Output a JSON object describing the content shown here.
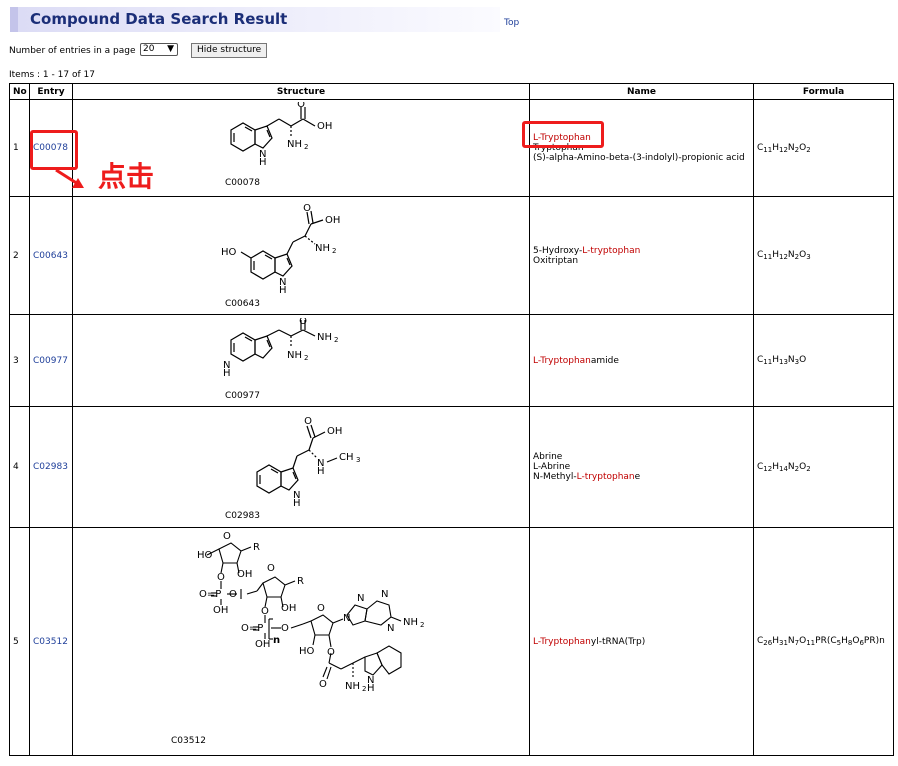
{
  "page": {
    "title": "Compound Data Search Result",
    "top_link": "Top",
    "entries_label": "Number of entries in a page",
    "entries_value": "20",
    "hide_button": "Hide structure",
    "items_text": "Items : 1 - 17 of 17",
    "annotation": "点击"
  },
  "table": {
    "headers": [
      "No",
      "Entry",
      "Structure",
      "Name",
      "Formula"
    ],
    "rows": [
      {
        "no": "1",
        "entry": "C00078",
        "struct_label": "C00078",
        "names": [
          [
            {
              "t": "L-Tryptophan",
              "hl": true
            }
          ],
          [
            {
              "t": "Tryptophan",
              "hl": false
            }
          ],
          [
            {
              "t": "(S)-alpha-Amino-beta-(3-indolyl)-propionic acid",
              "hl": false
            }
          ]
        ],
        "formula": [
          [
            "C",
            ""
          ],
          [
            "11",
            "sub"
          ],
          [
            "H",
            ""
          ],
          [
            "12",
            "sub"
          ],
          [
            "N",
            ""
          ],
          [
            "2",
            "sub"
          ],
          [
            "O",
            ""
          ],
          [
            "2",
            "sub"
          ]
        ]
      },
      {
        "no": "2",
        "entry": "C00643",
        "struct_label": "C00643",
        "names": [
          [
            {
              "t": "5-Hydroxy-",
              "hl": false
            },
            {
              "t": "L-tryptophan",
              "hl": true
            }
          ],
          [
            {
              "t": "Oxitriptan",
              "hl": false
            }
          ]
        ],
        "formula": [
          [
            "C",
            ""
          ],
          [
            "11",
            "sub"
          ],
          [
            "H",
            ""
          ],
          [
            "12",
            "sub"
          ],
          [
            "N",
            ""
          ],
          [
            "2",
            "sub"
          ],
          [
            "O",
            ""
          ],
          [
            "3",
            "sub"
          ]
        ]
      },
      {
        "no": "3",
        "entry": "C00977",
        "struct_label": "C00977",
        "names": [
          [
            {
              "t": "L-Tryptophan",
              "hl": true
            },
            {
              "t": "amide",
              "hl": false
            }
          ]
        ],
        "formula": [
          [
            "C",
            ""
          ],
          [
            "11",
            "sub"
          ],
          [
            "H",
            ""
          ],
          [
            "13",
            "sub"
          ],
          [
            "N",
            ""
          ],
          [
            "3",
            "sub"
          ],
          [
            "O",
            ""
          ]
        ]
      },
      {
        "no": "4",
        "entry": "C02983",
        "struct_label": "C02983",
        "names": [
          [
            {
              "t": "Abrine",
              "hl": false
            }
          ],
          [
            {
              "t": "L-Abrine",
              "hl": false
            }
          ],
          [
            {
              "t": "N-Methyl-",
              "hl": false
            },
            {
              "t": "L-tryptophan",
              "hl": true
            },
            {
              "t": "e",
              "hl": false
            }
          ]
        ],
        "formula": [
          [
            "C",
            ""
          ],
          [
            "12",
            "sub"
          ],
          [
            "H",
            ""
          ],
          [
            "14",
            "sub"
          ],
          [
            "N",
            ""
          ],
          [
            "2",
            "sub"
          ],
          [
            "O",
            ""
          ],
          [
            "2",
            "sub"
          ]
        ]
      },
      {
        "no": "5",
        "entry": "C03512",
        "struct_label": "C03512",
        "names": [
          [
            {
              "t": "L-Tryptophan",
              "hl": true
            },
            {
              "t": "yl-tRNA(Trp)",
              "hl": false
            }
          ]
        ],
        "formula": [
          [
            "C",
            ""
          ],
          [
            "26",
            "sub"
          ],
          [
            "H",
            ""
          ],
          [
            "31",
            "sub"
          ],
          [
            "N",
            ""
          ],
          [
            "7",
            "sub"
          ],
          [
            "O",
            ""
          ],
          [
            "11",
            "sub"
          ],
          [
            "PR(C",
            ""
          ],
          [
            "5",
            "sub"
          ],
          [
            "H",
            ""
          ],
          [
            "8",
            "sub"
          ],
          [
            "O",
            ""
          ],
          [
            "6",
            "sub"
          ],
          [
            "PR)n",
            ""
          ]
        ]
      }
    ]
  }
}
